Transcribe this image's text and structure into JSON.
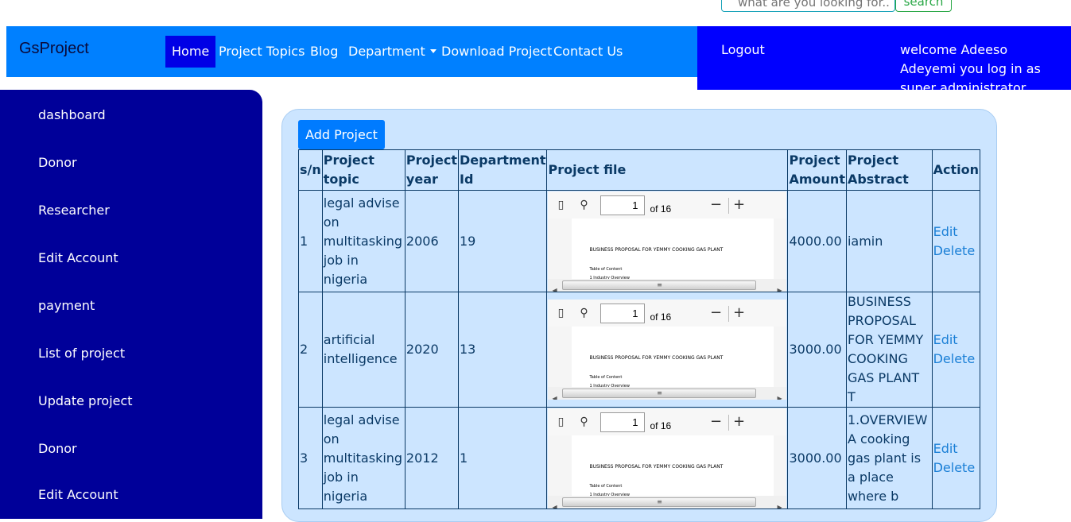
{
  "search": {
    "placeholder": "what are you looking for..",
    "button": "search"
  },
  "nav": {
    "brand": "GsProject",
    "items": [
      "Home",
      "Project Topics",
      "Blog",
      "Department",
      "Download Project",
      "Contact Us"
    ]
  },
  "user": {
    "logout": "Logout",
    "welcome": "welcome Adeeso Adeyemi you log in as super administrator"
  },
  "sidebar": {
    "items": [
      "dashboard",
      "Donor",
      "Researcher",
      "Edit Account",
      "payment",
      "List of project",
      "Update project",
      "Donor",
      "Edit Account"
    ]
  },
  "main": {
    "add_button": "Add Project",
    "columns": [
      "s/n",
      "Project topic",
      "Project year",
      "Department Id",
      "Project file",
      "Project Amount",
      "Project Abstract",
      "Action"
    ],
    "action_edit": "Edit",
    "action_delete": "Delete",
    "pdf": {
      "page": "1",
      "of": "of 16",
      "line1": "BUSINESS PROPOSAL FOR YEMMY COOKING GAS PLANT",
      "line2": "Table of Content",
      "line3": "1 Industry Overview"
    },
    "rows": [
      {
        "sn": "1",
        "topic": "legal advise on multitasking job in nigeria",
        "year": "2006",
        "dept": "19",
        "amount": "4000.00",
        "abstract": "iamin"
      },
      {
        "sn": "2",
        "topic": "artificial intelligence",
        "year": "2020",
        "dept": "13",
        "amount": "3000.00",
        "abstract": "BUSINESS PROPOSAL FOR YEMMY COOKING GAS PLANT T"
      },
      {
        "sn": "3",
        "topic": "legal advise on multitasking job in nigeria",
        "year": "2012",
        "dept": "1",
        "amount": "3000.00",
        "abstract": "1.OVERVIEW A cooking gas plant is a place where b"
      }
    ]
  },
  "colors": {
    "nav": "#0080ff",
    "userbar": "#0000ff",
    "sidebar": "#000099",
    "panel": "#cce5ff",
    "accent": "#007bff"
  }
}
